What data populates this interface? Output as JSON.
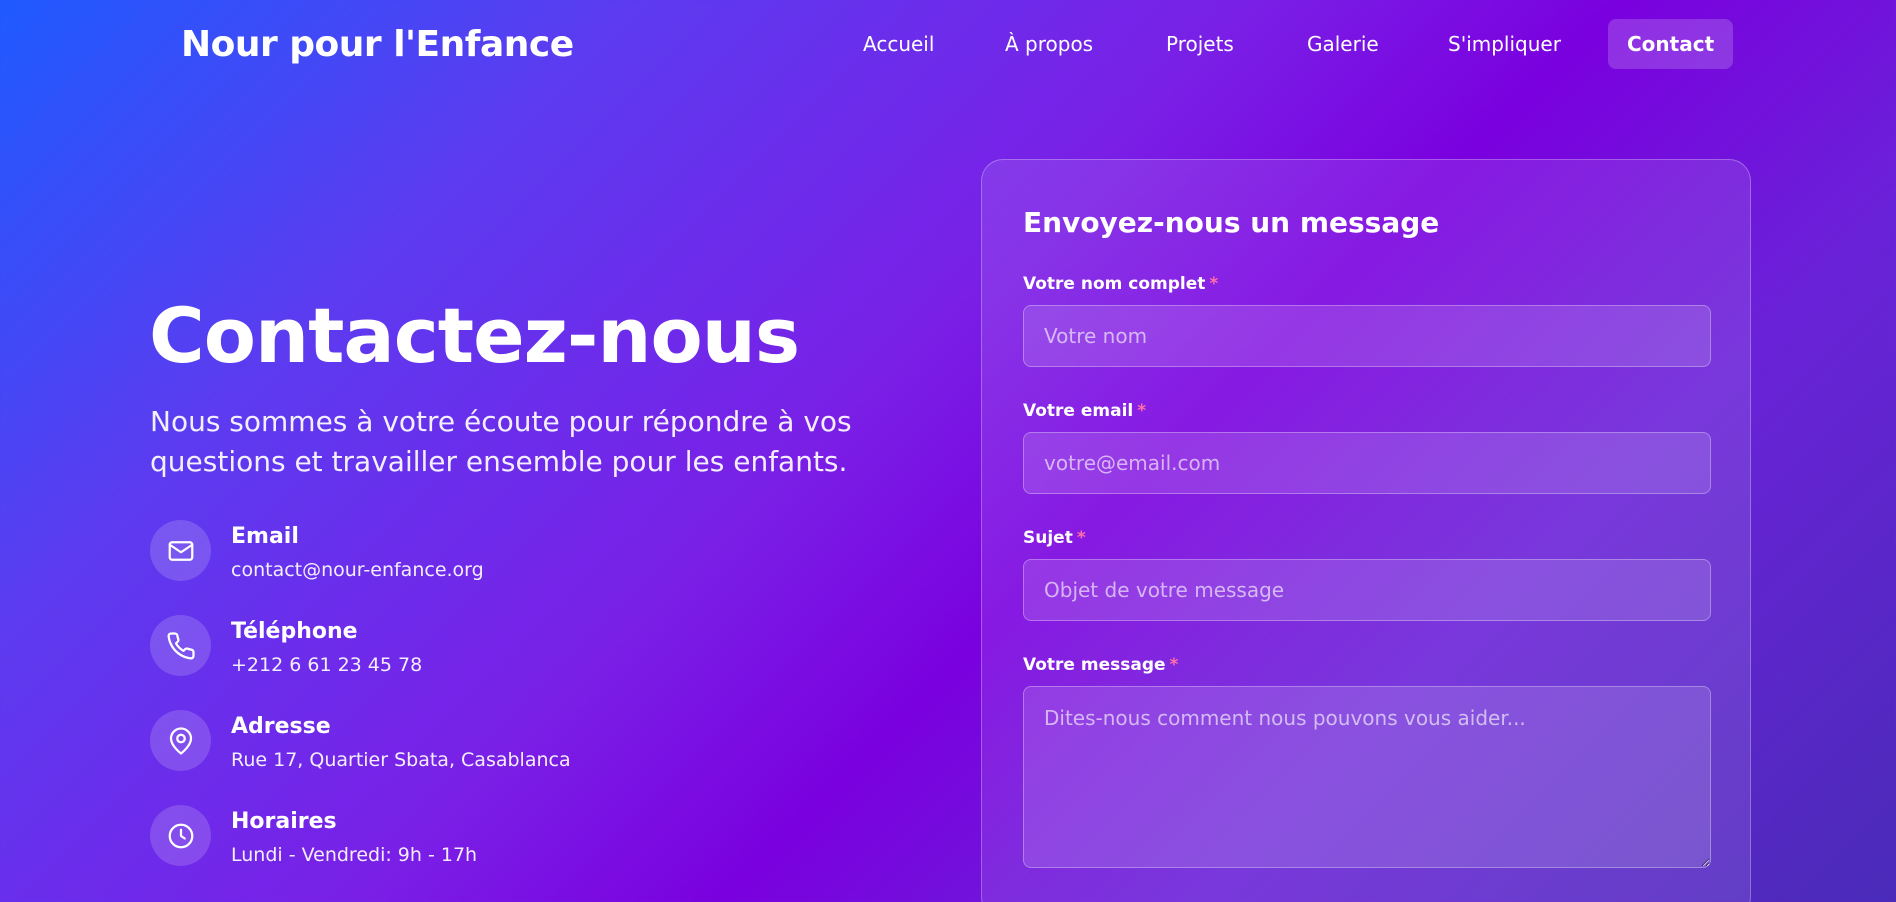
{
  "header": {
    "brand": "Nour pour l'Enfance",
    "nav": [
      {
        "label": "Accueil"
      },
      {
        "label": "À propos"
      },
      {
        "label": "Projets"
      },
      {
        "label": "Galerie"
      },
      {
        "label": "S'impliquer"
      },
      {
        "label": "Contact",
        "active": true
      }
    ]
  },
  "hero": {
    "title": "Contactez-nous",
    "subtitle": "Nous sommes à votre écoute pour répondre à vos questions et travailler ensemble pour les enfants."
  },
  "contact_info": [
    {
      "icon": "mail-icon",
      "label": "Email",
      "value": "contact@nour-enfance.org"
    },
    {
      "icon": "phone-icon",
      "label": "Téléphone",
      "value": "+212 6 61 23 45 78"
    },
    {
      "icon": "map-pin-icon",
      "label": "Adresse",
      "value": "Rue 17, Quartier Sbata, Casablanca"
    },
    {
      "icon": "clock-icon",
      "label": "Horaires",
      "value": "Lundi - Vendredi: 9h - 17h"
    }
  ],
  "form": {
    "title": "Envoyez-nous un message",
    "required_marker": "*",
    "fields": {
      "name": {
        "label": "Votre nom complet",
        "placeholder": "Votre nom",
        "value": ""
      },
      "email": {
        "label": "Votre email",
        "placeholder": "votre@email.com",
        "value": ""
      },
      "subject": {
        "label": "Sujet",
        "placeholder": "Objet de votre message",
        "value": ""
      },
      "message": {
        "label": "Votre message",
        "placeholder": "Dites-nous comment nous pouvons vous aider...",
        "value": ""
      }
    }
  },
  "colors": {
    "gradient_start": "#1e5bff",
    "gradient_mid": "#7a00df",
    "gradient_end": "#4a2bb8",
    "required": "#ff6fa8"
  }
}
